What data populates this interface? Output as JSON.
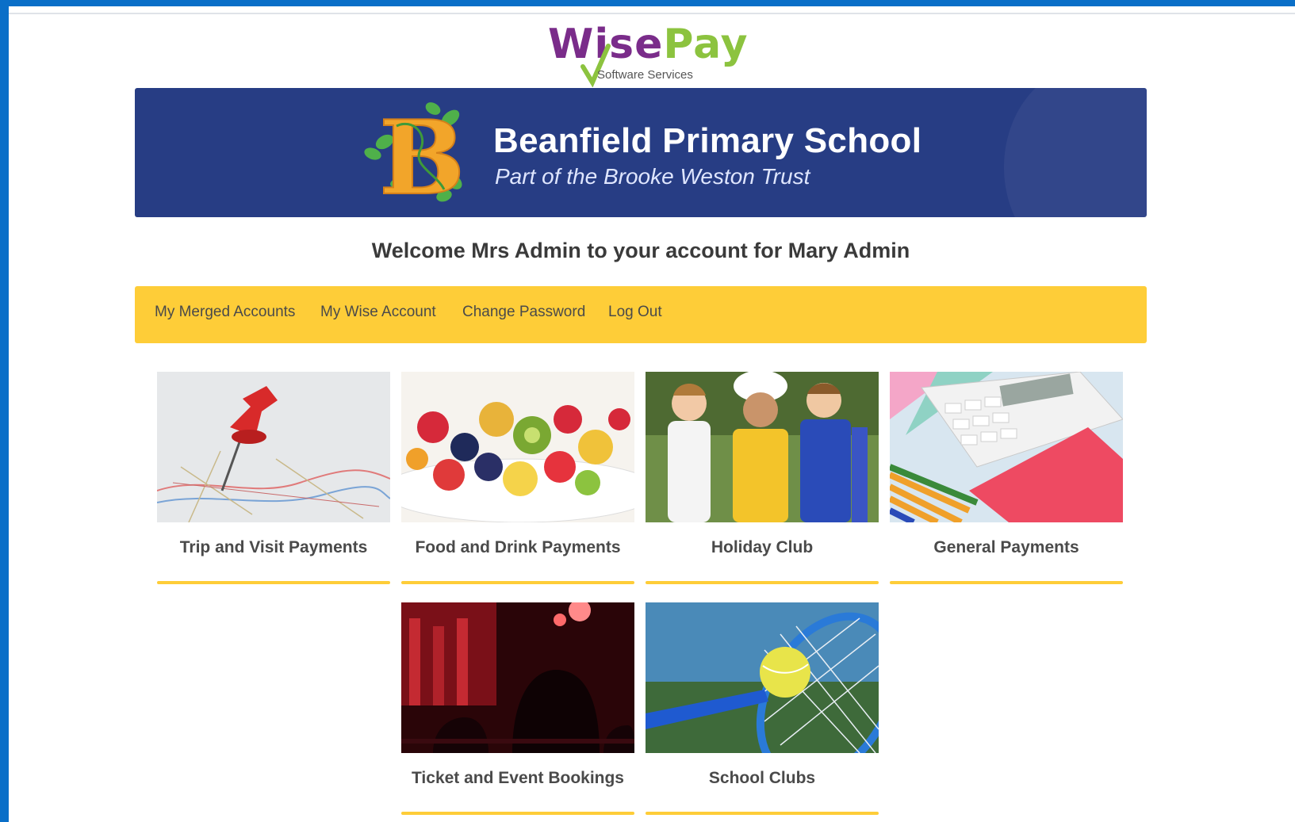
{
  "brand": {
    "logo_word_1": "Wise",
    "logo_word_2": "Pay",
    "logo_tagline": "Software Services"
  },
  "school": {
    "name": "Beanfield Primary School",
    "subtitle": "Part of the Brooke Weston Trust"
  },
  "welcome": "Welcome Mrs Admin to your account for Mary Admin",
  "nav": {
    "items": [
      {
        "label": "My Merged Accounts"
      },
      {
        "label": "My Wise Account"
      },
      {
        "label": "Change Password"
      },
      {
        "label": "Log Out"
      }
    ]
  },
  "tiles": [
    {
      "label": "Trip and Visit Payments",
      "icon": "map-pin-image"
    },
    {
      "label": "Food and Drink Payments",
      "icon": "fruit-bowl-image"
    },
    {
      "label": "Holiday Club",
      "icon": "children-image"
    },
    {
      "label": "General Payments",
      "icon": "calculator-image"
    },
    {
      "label": "Ticket and Event Bookings",
      "icon": "theatre-image"
    },
    {
      "label": "School Clubs",
      "icon": "tennis-image"
    }
  ],
  "colors": {
    "accent": "#fecd38",
    "banner": "#273d84",
    "outer": "#0a6fc8"
  }
}
